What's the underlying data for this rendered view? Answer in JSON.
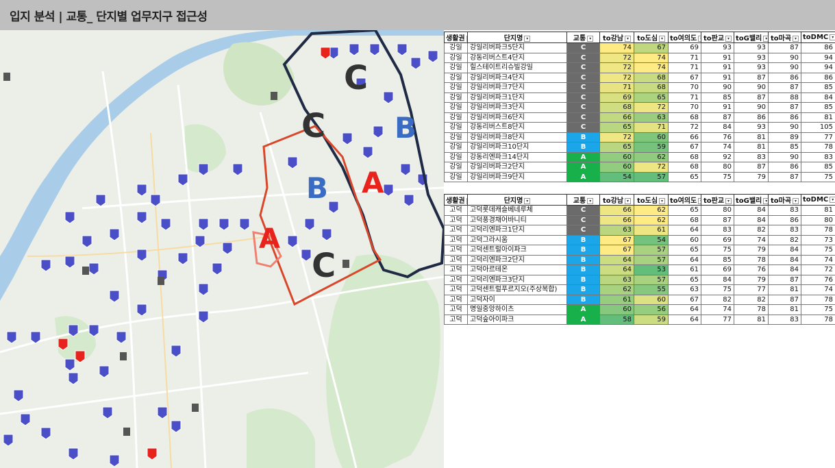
{
  "title": "입지 분석 | 교통_ 단지별 업무지구 접근성",
  "map": {
    "zone_letters": [
      {
        "text": "C",
        "color": "#333333"
      },
      {
        "text": "C",
        "color": "#333333"
      },
      {
        "text": "B",
        "color": "#3a6cc4"
      },
      {
        "text": "B",
        "color": "#3a6cc4"
      },
      {
        "text": "A",
        "color": "#e8231c"
      },
      {
        "text": "A",
        "color": "#e8231c"
      },
      {
        "text": "C",
        "color": "#333333"
      }
    ]
  },
  "table1": {
    "headers": [
      "생활권",
      "단지명",
      "교통",
      "to강남",
      "to도심",
      "to여의도",
      "to판교",
      "toG밸리",
      "to마곡",
      "toDMC"
    ],
    "rows": [
      [
        "강일",
        "강일리버파크5단지",
        "C",
        "74",
        "67",
        "69",
        "93",
        "93",
        "87",
        "86"
      ],
      [
        "강일",
        "강동리버스트4단지",
        "C",
        "72",
        "74",
        "71",
        "91",
        "93",
        "90",
        "94"
      ],
      [
        "강일",
        "힐스테이트리슈빌강일",
        "C",
        "72",
        "74",
        "71",
        "91",
        "93",
        "90",
        "94"
      ],
      [
        "강일",
        "강일리버파크4단지",
        "C",
        "72",
        "68",
        "67",
        "91",
        "87",
        "86",
        "86"
      ],
      [
        "강일",
        "강일리버파크7단지",
        "C",
        "71",
        "68",
        "70",
        "90",
        "90",
        "87",
        "85"
      ],
      [
        "강일",
        "강일리버파크1단지",
        "C",
        "69",
        "65",
        "71",
        "85",
        "87",
        "88",
        "84"
      ],
      [
        "강일",
        "강일리버파크3단지",
        "C",
        "68",
        "72",
        "70",
        "91",
        "90",
        "87",
        "85"
      ],
      [
        "강일",
        "강일리버파크6단지",
        "C",
        "66",
        "63",
        "68",
        "87",
        "86",
        "86",
        "81"
      ],
      [
        "강일",
        "강동리버스트8단지",
        "C",
        "65",
        "71",
        "72",
        "84",
        "93",
        "90",
        "105"
      ],
      [
        "강일",
        "강일리버파크8단지",
        "B",
        "72",
        "60",
        "66",
        "76",
        "81",
        "89",
        "77"
      ],
      [
        "강일",
        "강일리버파크10단지",
        "B",
        "65",
        "59",
        "67",
        "74",
        "81",
        "85",
        "78"
      ],
      [
        "강일",
        "강동리엔파크14단지",
        "A",
        "60",
        "62",
        "68",
        "92",
        "83",
        "90",
        "83"
      ],
      [
        "강일",
        "강일리버파크2단지",
        "A",
        "60",
        "72",
        "68",
        "80",
        "87",
        "86",
        "85"
      ],
      [
        "강일",
        "강일리버파크9단지",
        "A",
        "54",
        "57",
        "65",
        "75",
        "79",
        "87",
        "75"
      ]
    ]
  },
  "table2": {
    "headers": [
      "생활권",
      "단지명",
      "교통",
      "to강남",
      "to도심",
      "to여의도",
      "to판교",
      "toG밸리",
      "to마곡",
      "toDMC"
    ],
    "rows": [
      [
        "고덕",
        "고덕롯데캐슬베네루체",
        "C",
        "66",
        "62",
        "65",
        "80",
        "84",
        "83",
        "81"
      ],
      [
        "고덕",
        "고덕풍경채어바니티",
        "C",
        "66",
        "62",
        "68",
        "87",
        "84",
        "86",
        "80"
      ],
      [
        "고덕",
        "고덕리엔파크1단지",
        "C",
        "63",
        "61",
        "64",
        "83",
        "82",
        "83",
        "78"
      ],
      [
        "고덕",
        "고덕그라시움",
        "B",
        "67",
        "54",
        "60",
        "69",
        "74",
        "82",
        "73"
      ],
      [
        "고덕",
        "고덕센트럴아이파크",
        "B",
        "67",
        "57",
        "65",
        "75",
        "79",
        "84",
        "75"
      ],
      [
        "고덕",
        "고덕리엔파크2단지",
        "B",
        "64",
        "57",
        "64",
        "85",
        "78",
        "84",
        "74"
      ],
      [
        "고덕",
        "고덕아르테온",
        "B",
        "64",
        "53",
        "61",
        "69",
        "76",
        "84",
        "72"
      ],
      [
        "고덕",
        "고덕리엔파크3단지",
        "B",
        "63",
        "57",
        "65",
        "84",
        "79",
        "87",
        "76"
      ],
      [
        "고덕",
        "고덕센트럴푸르지오(주상복합)",
        "B",
        "62",
        "55",
        "63",
        "75",
        "77",
        "81",
        "74"
      ],
      [
        "고덕",
        "고덕자이",
        "B",
        "61",
        "60",
        "67",
        "82",
        "82",
        "87",
        "78"
      ],
      [
        "고덕",
        "명일중앙하이츠",
        "A",
        "60",
        "56",
        "64",
        "74",
        "78",
        "81",
        "75"
      ],
      [
        "고덕",
        "고덕숲아이파크",
        "A",
        "58",
        "59",
        "64",
        "77",
        "81",
        "83",
        "78"
      ]
    ]
  },
  "colors": {
    "grade_C": "#6b6b6b",
    "grade_B": "#1aa6e8",
    "grade_A": "#18b04b"
  }
}
